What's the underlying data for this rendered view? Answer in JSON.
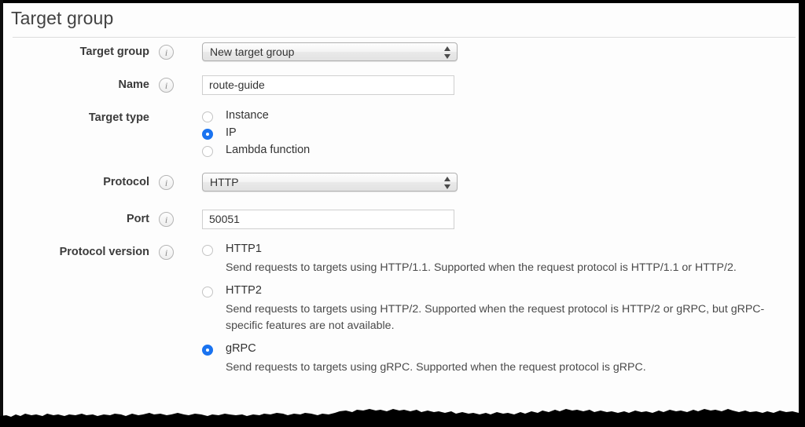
{
  "section": {
    "title": "Target group"
  },
  "fields": {
    "target_group": {
      "label": "Target group",
      "info_icon": "info-icon",
      "control": "select",
      "value": "New target group"
    },
    "name": {
      "label": "Name",
      "info_icon": "info-icon",
      "control": "text",
      "value": "route-guide",
      "placeholder": ""
    },
    "target_type": {
      "label": "Target type",
      "info_icon": "info-icon",
      "control": "radio-group",
      "options": [
        {
          "label": "Instance",
          "selected": false
        },
        {
          "label": "IP",
          "selected": true
        },
        {
          "label": "Lambda function",
          "selected": false
        }
      ]
    },
    "protocol": {
      "label": "Protocol",
      "info_icon": "info-icon",
      "control": "select",
      "value": "HTTP"
    },
    "port": {
      "label": "Port",
      "info_icon": "info-icon",
      "control": "text",
      "value": "50051",
      "placeholder": ""
    },
    "protocol_version": {
      "label": "Protocol version",
      "info_icon": "info-icon",
      "control": "radio-group",
      "options": [
        {
          "label": "HTTP1",
          "selected": false,
          "description": "Send requests to targets using HTTP/1.1. Supported when the request protocol is HTTP/1.1 or HTTP/2."
        },
        {
          "label": "HTTP2",
          "selected": false,
          "description": "Send requests to targets using HTTP/2. Supported when the request protocol is HTTP/2 or gRPC, but gRPC-specific features are not available."
        },
        {
          "label": "gRPC",
          "selected": true,
          "description": "Send requests to targets using gRPC. Supported when the request protocol is gRPC."
        }
      ]
    }
  },
  "colors": {
    "accent": "#1a73f0",
    "label_text": "#3b3b3b",
    "body_text": "#333333",
    "divider": "#dcdcdc",
    "border": "#000000"
  },
  "icons": {
    "info": "i",
    "stepper": "stepper-up-down-icon"
  }
}
